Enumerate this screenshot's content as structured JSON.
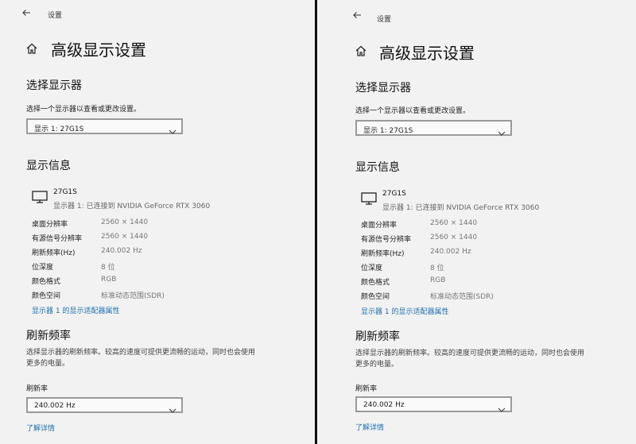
{
  "window": {
    "title": "设置"
  },
  "page": {
    "title": "高级显示设置"
  },
  "select_display": {
    "heading": "选择显示器",
    "hint": "选择一个显示器以查看或更改设置。",
    "selected": "显示 1: 27G1S"
  },
  "display_info": {
    "heading": "显示信息",
    "monitor_name": "27G1S",
    "monitor_sub": "显示器 1: 已连接到 NVIDIA GeForce RTX 3060",
    "rows": [
      {
        "key": "桌面分辨率",
        "value": "2560 × 1440"
      },
      {
        "key": "有源信号分辨率",
        "value": "2560 × 1440"
      },
      {
        "key": "刷新频率(Hz)",
        "value": "240.002 Hz"
      },
      {
        "key": "位深度",
        "value": "8 位"
      },
      {
        "key": "颜色格式",
        "value": "RGB"
      },
      {
        "key": "颜色空间",
        "value": "标准动态范围(SDR)"
      }
    ],
    "adapter_link": "显示器 1 的显示适配器属性"
  },
  "refresh": {
    "heading": "刷新频率",
    "desc_line1": "选择显示器的刷新频率。较高的速度可提供更流畅的运动，同时也会使用",
    "desc_line2": "更多的电量。",
    "label": "刷新率",
    "selected": "240.002 Hz",
    "learn_more": "了解详情"
  }
}
